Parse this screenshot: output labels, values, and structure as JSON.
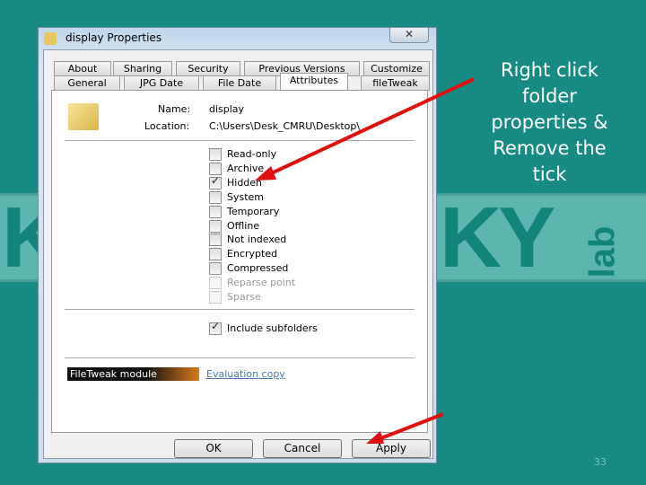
{
  "background_logo": {
    "letters_left": "K",
    "letters_right": "KY",
    "suffix": "lab"
  },
  "dialog": {
    "title": "display Properties",
    "tabs_row1": [
      "About",
      "Sharing",
      "Security",
      "Previous Versions",
      "Customize"
    ],
    "tabs_row2": [
      "General",
      "JPG Date",
      "File Date",
      "Attributes",
      "fileTweak"
    ],
    "active_tab": "Attributes",
    "name_label": "Name:",
    "name_value": "display",
    "location_label": "Location:",
    "location_value": "C:\\Users\\Desk_CMRU\\Desktop\\",
    "attributes": [
      {
        "label": "Read-only",
        "checked": false,
        "enabled": true
      },
      {
        "label": "Archive",
        "checked": false,
        "enabled": true
      },
      {
        "label": "Hidden",
        "checked": true,
        "enabled": true
      },
      {
        "label": "System",
        "checked": false,
        "enabled": true
      },
      {
        "label": "Temporary",
        "checked": false,
        "enabled": true
      },
      {
        "label": "Offline",
        "checked": false,
        "enabled": true
      },
      {
        "label": "Not indexed",
        "checked": false,
        "enabled": true
      },
      {
        "label": "Encrypted",
        "checked": false,
        "enabled": true
      },
      {
        "label": "Compressed",
        "checked": false,
        "enabled": true
      },
      {
        "label": "Reparse point",
        "checked": false,
        "enabled": false
      },
      {
        "label": "Sparse",
        "checked": false,
        "enabled": false
      }
    ],
    "include_subfolders": {
      "label": "Include subfolders",
      "checked": true
    },
    "banner": "FileTweak module",
    "evaluation_link": "Evaluation copy",
    "buttons": {
      "ok": "OK",
      "cancel": "Cancel",
      "apply": "Apply"
    }
  },
  "annotation": {
    "lines": [
      "Right click",
      "folder",
      "properties &",
      "Remove the",
      "tick"
    ],
    "arrow_color": "#e01010"
  },
  "page_number": "33"
}
